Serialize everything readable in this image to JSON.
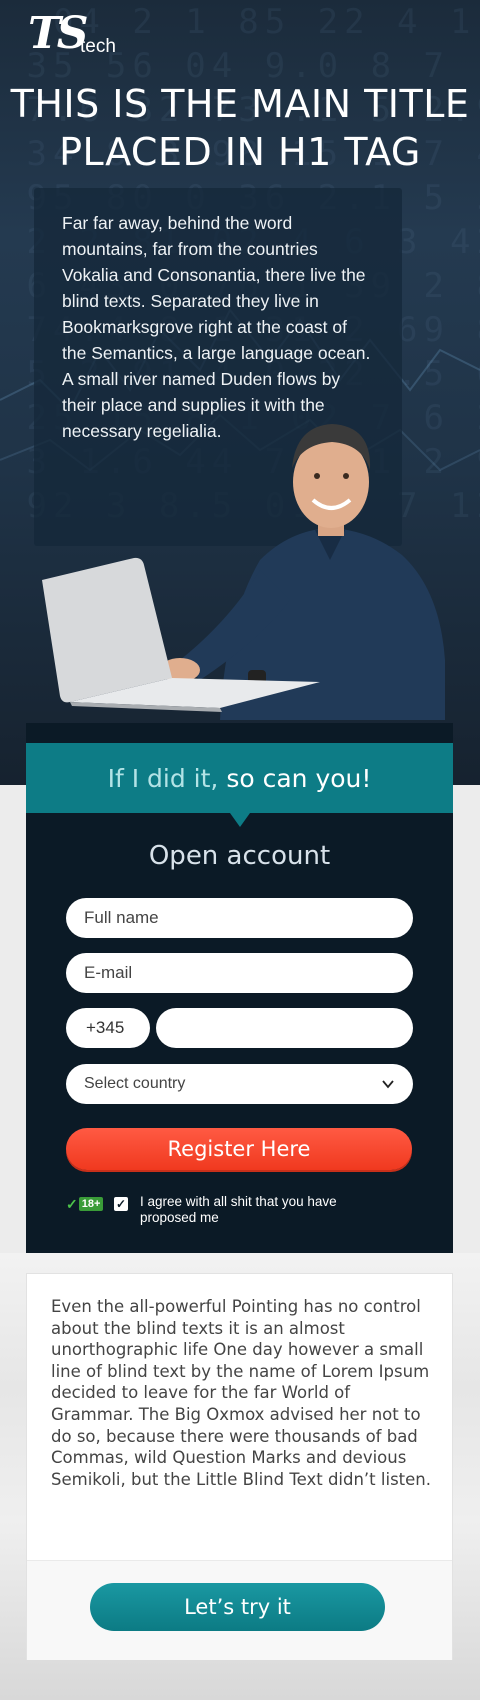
{
  "brand": {
    "logo_mark": "TS",
    "logo_word": "tech"
  },
  "hero": {
    "title_line1": "THIS IS THE MAIN TITLE",
    "title_line2": "PLACED IN H1 TAG",
    "intro": "Far far away, behind the word mountains, far from the countries Vokalia and Consonantia, there live the blind texts. Separated they live in Bookmarksgrove right at the coast of the Semantics, a large language ocean. A small river named Duden flows by their place and supplies it with the necessary regelialia."
  },
  "form": {
    "banner_light": "If I did it,",
    "banner_strong": " so can you!",
    "title": "Open account",
    "full_name_placeholder": "Full name",
    "email_placeholder": "E-mail",
    "phone_code": "+345",
    "phone_placeholder": "",
    "country_select": "Select country",
    "register_label": "Register Here",
    "age_badge": "18+",
    "agree_checked": true,
    "agree_text": "I agree with all shit that you have proposed me"
  },
  "card": {
    "body": "Even the all-powerful Pointing has no control about the blind texts it is an almost unorthographic life One day however a small line of blind text by the name of Lorem Ipsum decided to leave for the far World of Grammar. The Big Oxmox advised her not to do so, because there were thousands of bad Commas, wild Question Marks and devious Semikoli, but the Little Blind Text didn’t listen.",
    "button_label": "Let’s try it"
  },
  "colors": {
    "hero_bg": "#1f3347",
    "panel_bg": "#0b1a26",
    "teal": "#0d7c86",
    "register": "#f0391f"
  }
}
